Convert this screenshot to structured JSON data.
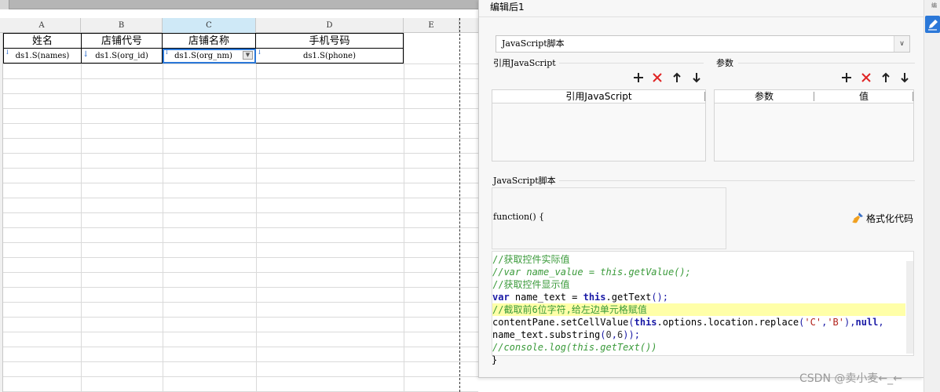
{
  "sheet": {
    "columns": [
      "A",
      "B",
      "C",
      "D",
      "E"
    ],
    "header_row": [
      "姓名",
      "店铺代号",
      "店铺名称",
      "手机号码"
    ],
    "data_row": [
      "ds1.S(names)",
      "ds1.S(org_id)",
      "ds1.S(org_nm)",
      "ds1.S(phone)"
    ]
  },
  "dialog": {
    "title": "编辑后1",
    "type_select": {
      "value": "JavaScript脚本"
    },
    "ref_js": {
      "label": "引用JavaScript",
      "column_header": "引用JavaScript",
      "toolbar": [
        "add-icon",
        "delete-icon",
        "move-up-icon",
        "move-down-icon"
      ]
    },
    "params": {
      "label": "参数",
      "columns": [
        "参数",
        "值"
      ],
      "toolbar": [
        "add-icon",
        "delete-icon",
        "move-up-icon",
        "move-down-icon"
      ]
    },
    "script": {
      "label": "JavaScript脚本",
      "function_header": "function() {",
      "format_button": "格式化代码",
      "closing_brace": "}",
      "code_lines": [
        "//获取控件实际值",
        "//var name_value = this.getValue();",
        "//获取控件显示值",
        "var name_text = this.getText();",
        "//截取前6位字符,给左边单元格赋值",
        "contentPane.setCellValue(this.options.location.replace('C','B'),null,",
        "name_text.substring(0,6));",
        "//console.log(this.getText())"
      ],
      "highlighted_line": 4
    }
  },
  "watermark": "CSDN @卖小麦←_←",
  "right_strip_text": "编",
  "colors": {
    "selection": "#2b78d8",
    "comment": "#3a9a3a",
    "keyword": "#1a1aa6",
    "string": "#b2221a",
    "delete": "#e02424",
    "highlight": "#ffffa8"
  }
}
